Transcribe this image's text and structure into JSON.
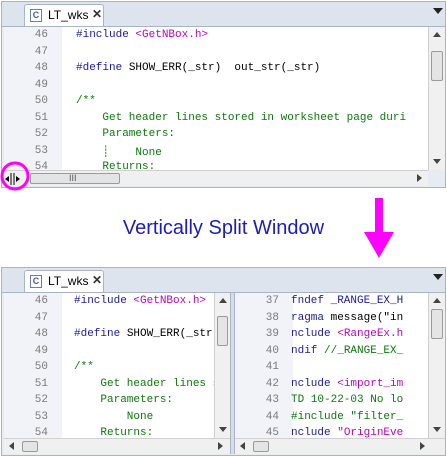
{
  "accent_color": "#ff00ff",
  "caption_color": "#1c1cb8",
  "top_window": {
    "tab_label": "LT_wks",
    "tab_icon": "C",
    "tab_close": "✕",
    "lines": [
      "46",
      "47",
      "48",
      "49",
      "50",
      "51",
      "52",
      "53",
      "54"
    ],
    "code": [
      [
        {
          "t": "#include ",
          "c": "blue"
        },
        {
          "t": "<GetNBox.h>",
          "c": "mag"
        }
      ],
      [],
      [
        {
          "t": "#define ",
          "c": "blue"
        },
        {
          "t": "SHOW_ERR(_str)  out_str(_str)",
          "c": ""
        }
      ],
      [],
      [
        {
          "t": "/**",
          "c": "green"
        }
      ],
      [
        {
          "t": "    Get header lines stored in worksheet page duri",
          "c": "green"
        }
      ],
      [
        {
          "t": "    Parameters:",
          "c": "green"
        }
      ],
      [
        {
          "t": "    ┊    None",
          "c": "green"
        }
      ],
      [
        {
          "t": "    Returns:",
          "c": "green"
        }
      ]
    ],
    "hscroll_grip": "III"
  },
  "caption": "Vertically Split Window",
  "bottom_window": {
    "tab_label": "LT_wks",
    "tab_icon": "C",
    "tab_close": "✕",
    "left_pane": {
      "lines": [
        "46",
        "47",
        "48",
        "49",
        "50",
        "51",
        "52",
        "53",
        "54"
      ],
      "code": [
        [
          {
            "t": "#include ",
            "c": "blue"
          },
          {
            "t": "<GetNBox.h>",
            "c": "mag"
          }
        ],
        [],
        [
          {
            "t": "#define ",
            "c": "blue"
          },
          {
            "t": "SHOW_ERR(_str)",
            "c": ""
          }
        ],
        [],
        [
          {
            "t": "/**",
            "c": "green"
          }
        ],
        [
          {
            "t": "    Get header lines s",
            "c": "green"
          }
        ],
        [
          {
            "t": "    Parameters:",
            "c": "green"
          }
        ],
        [
          {
            "t": "        None",
            "c": "green"
          }
        ],
        [
          {
            "t": "    Returns:",
            "c": "green"
          }
        ]
      ]
    },
    "right_pane": {
      "lines": [
        "37",
        "38",
        "39",
        "40",
        "41",
        "42",
        "43",
        "44",
        "45"
      ],
      "code": [
        [
          {
            "t": "fndef _RANGE_EX_H",
            "c": "blue"
          }
        ],
        [
          {
            "t": "ragma ",
            "c": "blue"
          },
          {
            "t": "message(\"in",
            "c": ""
          }
        ],
        [
          {
            "t": "nclude ",
            "c": "blue"
          },
          {
            "t": "<RangeEx.h",
            "c": "mag"
          }
        ],
        [
          {
            "t": "ndif ",
            "c": "blue"
          },
          {
            "t": "//_RANGE_EX_",
            "c": "green"
          }
        ],
        [],
        [
          {
            "t": "nclude ",
            "c": "blue"
          },
          {
            "t": "<import_im",
            "c": "mag"
          }
        ],
        [
          {
            "t": "TD 10-22-03 No lo",
            "c": "green"
          }
        ],
        [
          {
            "t": "#include \"filter_",
            "c": "green"
          }
        ],
        [
          {
            "t": "nclude ",
            "c": "blue"
          },
          {
            "t": "\"OriginEve",
            "c": "mag"
          }
        ]
      ]
    }
  }
}
